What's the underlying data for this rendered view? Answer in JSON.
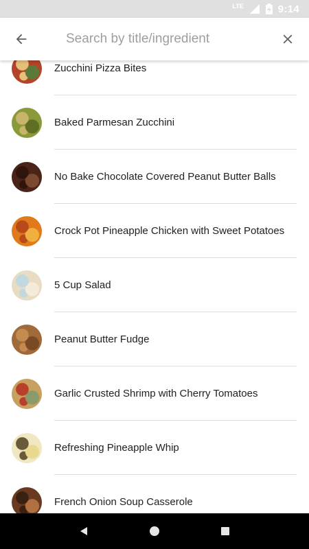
{
  "status_bar": {
    "network": "LTE",
    "time": "9:14"
  },
  "search": {
    "placeholder": "Search by title/ingredient",
    "value": "",
    "back_icon": "arrow-back-icon",
    "clear_icon": "close-icon"
  },
  "recipes": [
    {
      "title": "Zucchini Pizza Bites",
      "image": "zucchini-pizza-bites-photo",
      "colors": [
        "#b2442a",
        "#e4c07a",
        "#5a7a3a"
      ]
    },
    {
      "title": "Baked Parmesan Zucchini",
      "image": "baked-parmesan-zucchini-photo",
      "colors": [
        "#8a9a3a",
        "#c9b56a",
        "#5e6e24"
      ]
    },
    {
      "title": "No Bake Chocolate Covered Peanut Butter Balls",
      "image": "chocolate-peanut-butter-balls-photo",
      "colors": [
        "#4a2418",
        "#2e140c",
        "#7a4a30"
      ]
    },
    {
      "title": "Crock Pot Pineapple Chicken with Sweet Potatoes",
      "image": "pineapple-chicken-photo",
      "colors": [
        "#e07a1a",
        "#b84a1a",
        "#f0b040"
      ]
    },
    {
      "title": "5 Cup Salad",
      "image": "five-cup-salad-photo",
      "colors": [
        "#e8dcc4",
        "#c0d8e0",
        "#f4ecd8"
      ]
    },
    {
      "title": "Peanut Butter Fudge",
      "image": "peanut-butter-fudge-photo",
      "colors": [
        "#a06a3a",
        "#c48a50",
        "#7a4a24"
      ]
    },
    {
      "title": "Garlic Crusted Shrimp with Cherry Tomatoes",
      "image": "garlic-shrimp-photo",
      "colors": [
        "#c8a060",
        "#b8402a",
        "#8a9a6a"
      ]
    },
    {
      "title": "Refreshing Pineapple Whip",
      "image": "pineapple-whip-photo",
      "colors": [
        "#f0e8c0",
        "#6a5a3a",
        "#e8d890"
      ]
    },
    {
      "title": "French Onion Soup Casserole",
      "image": "french-onion-casserole-photo",
      "colors": [
        "#6a3a20",
        "#3a2010",
        "#b07040"
      ]
    }
  ],
  "nav_bar": {
    "back_icon": "nav-back-icon",
    "home_icon": "nav-home-icon",
    "recents_icon": "nav-recents-icon"
  }
}
